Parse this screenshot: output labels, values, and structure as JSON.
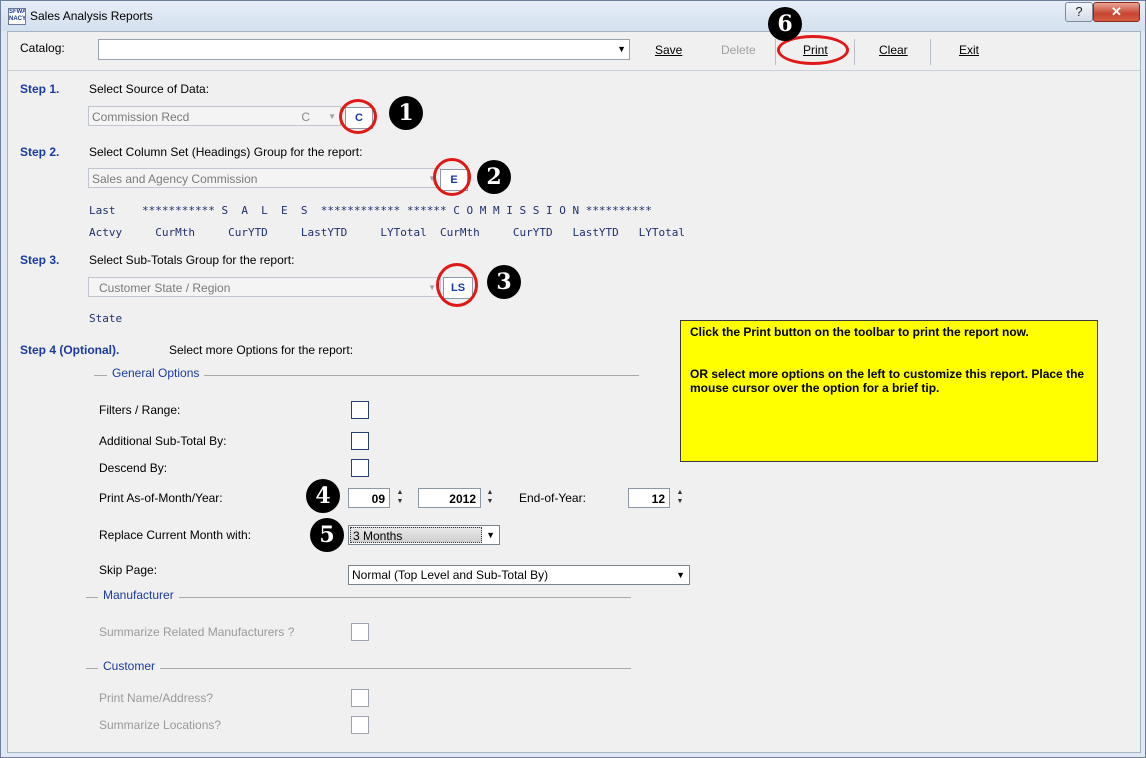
{
  "window": {
    "title": "Sales Analysis Reports",
    "icon_text": "SFWA NACY",
    "help_label": "?",
    "close_label": "✕"
  },
  "toolbar": {
    "catalog_label": "Catalog:",
    "catalog_value": "",
    "save_label": "Save",
    "delete_label": "Delete",
    "print_label": "Print",
    "clear_label": "Clear",
    "exit_label": "Exit"
  },
  "step1": {
    "label": "Step 1.",
    "prompt": "Select Source of Data:",
    "select_value": "Commission Recd",
    "select_code": "C",
    "code": "C"
  },
  "step2": {
    "label": "Step 2.",
    "prompt": "Select Column Set (Headings) Group for the report:",
    "select_value": "Sales and Agency Commission",
    "code": "E",
    "heading_line1": "Last    *********** S  A  L  E  S  ************ ****** C O M M I S S I O N **********",
    "heading_line2": "Actvy     CurMth     CurYTD     LastYTD     LYTotal  CurMth     CurYTD   LastYTD   LYTotal"
  },
  "step3": {
    "label": "Step 3.",
    "prompt": "Select Sub-Totals Group for the report:",
    "select_value": "Customer State / Region",
    "code": "LS",
    "heading": "State"
  },
  "step4": {
    "label": "Step 4 (Optional).",
    "prompt": "Select more Options for the report:"
  },
  "general_options": {
    "title": "General Options",
    "filters_label": "Filters / Range:",
    "additional_subtotal_label": "Additional Sub-Total By:",
    "descend_label": "Descend By:",
    "print_asof_label": "Print As-of-Month/Year:",
    "month_value": "09",
    "year_value": "2012",
    "end_of_year_label": "End-of-Year:",
    "end_of_year_value": "12",
    "replace_label": "Replace Current Month with:",
    "replace_value": "3 Months",
    "skip_page_label": "Skip Page:",
    "skip_page_value": "Normal (Top Level and Sub-Total By)"
  },
  "manufacturer": {
    "title": "Manufacturer",
    "summarize_label": "Summarize Related Manufacturers ?"
  },
  "customer": {
    "title": "Customer",
    "print_name_label": "Print Name/Address?",
    "summarize_locations_label": "Summarize Locations?"
  },
  "tip": {
    "line1": "Click the Print button on the toolbar to print the report now.",
    "line2": "OR select more options on the left to customize this report. Place the mouse cursor over the option for a brief tip."
  },
  "annotations": [
    "1",
    "2",
    "3",
    "4",
    "5",
    "6"
  ],
  "colors": {
    "step_label": "#1b3a9e",
    "tip_background": "#ffff00",
    "annotation_ring": "#e01818"
  }
}
